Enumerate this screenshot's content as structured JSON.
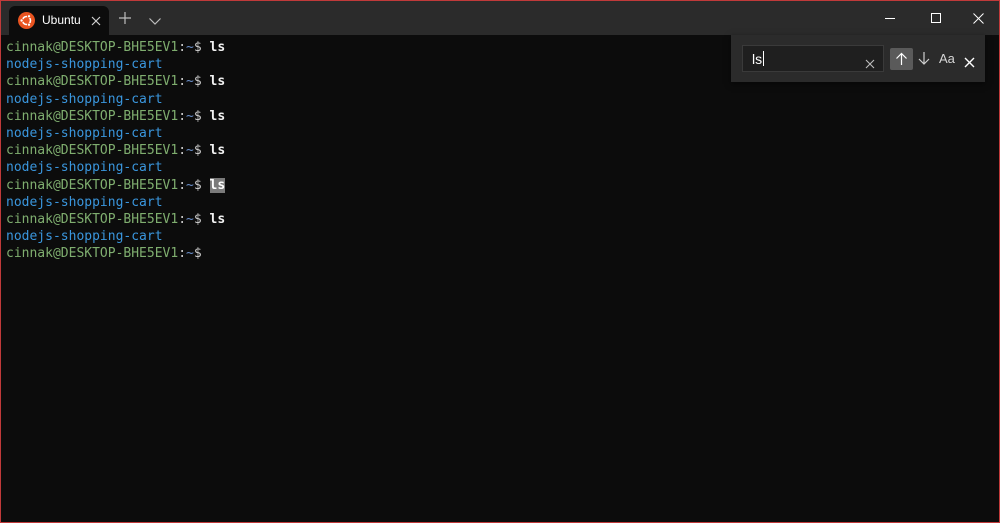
{
  "window": {
    "accent_border": "#c03a3a"
  },
  "tab": {
    "title": "Ubuntu",
    "icon": "ubuntu-icon",
    "icon_color": "#e95420"
  },
  "titlebar_buttons": {
    "new_tab_icon": "plus-icon",
    "dropdown_icon": "chevron-down-icon",
    "minimize_icon": "minimize-icon",
    "maximize_icon": "maximize-icon",
    "close_icon": "close-icon"
  },
  "terminal": {
    "colors": {
      "background": "#0c0c0c",
      "user": "#7fae6f",
      "path": "#6a8fc9",
      "output": "#3a96dd",
      "command": "#f2f2f2"
    },
    "lines": [
      {
        "type": "prompt",
        "user": "cinnak@DESKTOP-BHE5EV1",
        "sep": ":",
        "path": "~",
        "dollar": "$",
        "command": "ls"
      },
      {
        "type": "output",
        "text": "nodejs-shopping-cart"
      },
      {
        "type": "prompt",
        "user": "cinnak@DESKTOP-BHE5EV1",
        "sep": ":",
        "path": "~",
        "dollar": "$",
        "command": "ls"
      },
      {
        "type": "output",
        "text": "nodejs-shopping-cart"
      },
      {
        "type": "prompt",
        "user": "cinnak@DESKTOP-BHE5EV1",
        "sep": ":",
        "path": "~",
        "dollar": "$",
        "command": "ls"
      },
      {
        "type": "output",
        "text": "nodejs-shopping-cart"
      },
      {
        "type": "prompt",
        "user": "cinnak@DESKTOP-BHE5EV1",
        "sep": ":",
        "path": "~",
        "dollar": "$",
        "command": "ls"
      },
      {
        "type": "output",
        "text": "nodejs-shopping-cart"
      },
      {
        "type": "prompt",
        "user": "cinnak@DESKTOP-BHE5EV1",
        "sep": ":",
        "path": "~",
        "dollar": "$",
        "command": "ls",
        "highlighted": true
      },
      {
        "type": "output",
        "text": "nodejs-shopping-cart"
      },
      {
        "type": "prompt",
        "user": "cinnak@DESKTOP-BHE5EV1",
        "sep": ":",
        "path": "~",
        "dollar": "$",
        "command": "ls"
      },
      {
        "type": "output",
        "text": "nodejs-shopping-cart"
      },
      {
        "type": "prompt",
        "user": "cinnak@DESKTOP-BHE5EV1",
        "sep": ":",
        "path": "~",
        "dollar": "$",
        "command": ""
      }
    ]
  },
  "find": {
    "query": "ls",
    "clear_icon": "clear-icon",
    "search_up_icon": "arrow-up-icon",
    "search_down_icon": "arrow-down-icon",
    "case_label": "Aa",
    "close_icon": "close-icon"
  }
}
